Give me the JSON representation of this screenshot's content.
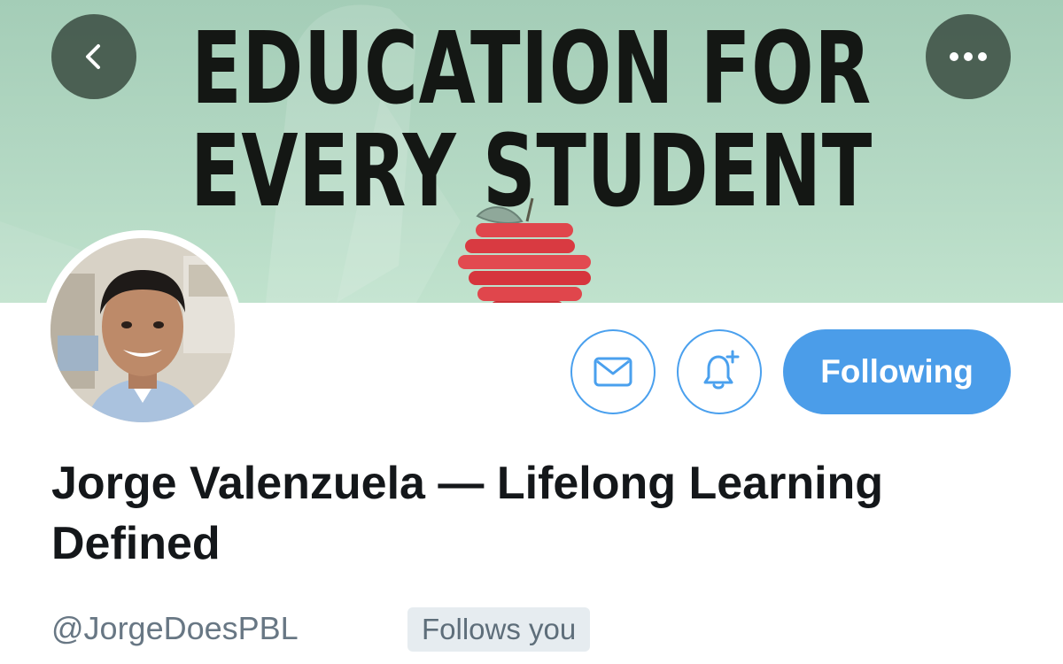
{
  "banner": {
    "headline_line1": "EDUCATION FOR",
    "headline_line2": "EVERY STUDENT",
    "background_color": "#b3d8c3",
    "art_icon": "apple-icon"
  },
  "nav": {
    "back_icon": "chevron-left-icon",
    "more_icon": "more-horizontal-icon"
  },
  "profile": {
    "display_name": "Jorge Valenzuela — Lifelong Learning Defined",
    "handle": "@JorgeDoesPBL",
    "follows_you_badge": "Follows you"
  },
  "actions": {
    "message_icon": "envelope-icon",
    "notify_icon": "bell-plus-icon",
    "follow_button_label": "Following",
    "accent_color": "#4b9de9"
  }
}
